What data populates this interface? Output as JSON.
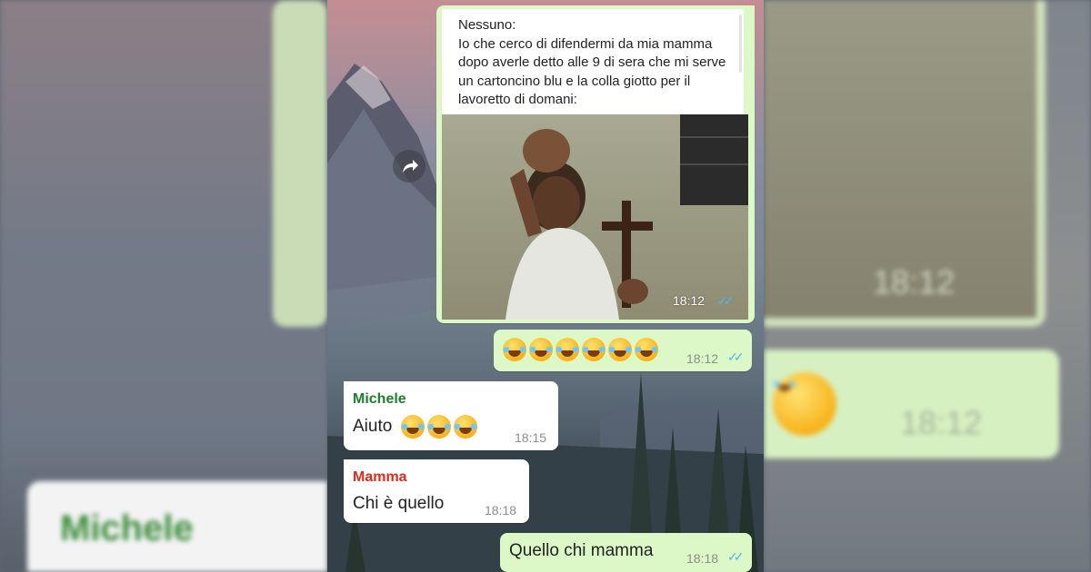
{
  "meme": {
    "caption_lines": [
      "Nessuno:",
      "Io che cerco di difendermi da mia mamma",
      "dopo averle detto alle 9 di sera che mi serve",
      "un cartoncino blu e la colla giotto per il",
      "lavoretto di domani:"
    ],
    "time": "18:12",
    "ticks": "✓✓"
  },
  "messages": [
    {
      "sender": "",
      "text": "",
      "emoji_count": 6,
      "time": "18:12",
      "ticks": "✓✓"
    },
    {
      "sender": "Michele",
      "text": "Aiuto",
      "emoji_count": 3,
      "time": "18:15"
    },
    {
      "sender": "Mamma",
      "text": "Chi è quello",
      "time": "18:18"
    },
    {
      "sender": "",
      "text": "Quello chi mamma",
      "time": "18:18",
      "ticks": "✓✓"
    }
  ],
  "blurred_background": {
    "right_time_top": "18:12",
    "right_time_bottom": "18:12",
    "left_sender": "Michele"
  },
  "colors": {
    "outgoing_bubble": "#dcf8c6",
    "incoming_bubble": "#ffffff",
    "michele_name": "#1e7f2e",
    "mamma_name": "#e02a1a",
    "read_ticks": "#4fb6ec"
  },
  "icons": [
    "forward-arrow-icon",
    "double-check-icon",
    "tears-of-joy-emoji"
  ]
}
